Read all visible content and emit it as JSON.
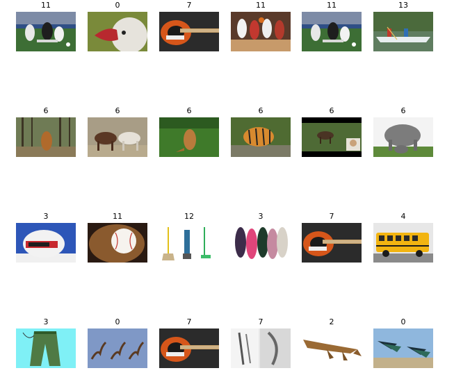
{
  "grid": {
    "items": [
      {
        "label": "11",
        "image": "soccer-players-image"
      },
      {
        "label": "0",
        "image": "duck-head-image"
      },
      {
        "label": "7",
        "image": "bass-guitar-image"
      },
      {
        "label": "11",
        "image": "basketball-players-image"
      },
      {
        "label": "11",
        "image": "soccer-players-image"
      },
      {
        "label": "13",
        "image": "canoe-image"
      },
      {
        "label": "6",
        "image": "kangaroo-forest-image"
      },
      {
        "label": "6",
        "image": "horses-image"
      },
      {
        "label": "6",
        "image": "kangaroo-grass-image"
      },
      {
        "label": "6",
        "image": "tiger-image"
      },
      {
        "label": "6",
        "image": "deer-video-image"
      },
      {
        "label": "6",
        "image": "elephants-image"
      },
      {
        "label": "3",
        "image": "racing-helmet-image"
      },
      {
        "label": "11",
        "image": "baseball-glove-image"
      },
      {
        "label": "12",
        "image": "cleaning-tools-image"
      },
      {
        "label": "3",
        "image": "flip-flops-image"
      },
      {
        "label": "7",
        "image": "bass-guitar-image"
      },
      {
        "label": "4",
        "image": "school-bus-image"
      },
      {
        "label": "3",
        "image": "pants-sketch-image"
      },
      {
        "label": "0",
        "image": "swallows-image"
      },
      {
        "label": "7",
        "image": "bass-guitar-image"
      },
      {
        "label": "7",
        "image": "sketch-drawings-image"
      },
      {
        "label": "2",
        "image": "crocodile-image"
      },
      {
        "label": "0",
        "image": "flying-ducks-image"
      }
    ]
  }
}
